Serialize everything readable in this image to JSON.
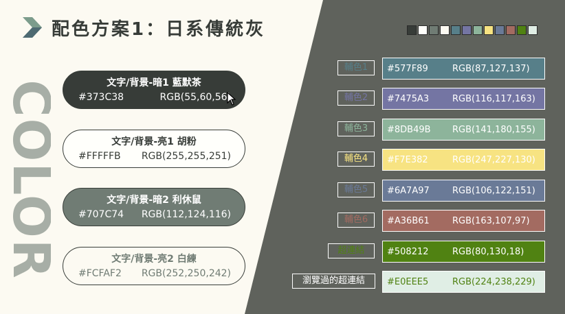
{
  "title": "配色方案1：日系傳統灰",
  "side_word": "COLOR",
  "colors": {
    "page_light": "#FCFAF2",
    "page_dark": "#5F625C",
    "chevron_light": "#7C9C8C",
    "chevron_dark": "#4E6A72",
    "side_word": "#A7AEA6"
  },
  "main_colors": [
    {
      "name": "文字/背景-暗1 藍默茶",
      "hex": "#373C38",
      "rgb": "RGB(55,60,56)",
      "fill": "#373C38",
      "text": "#FFFFFF",
      "border": "#373C38"
    },
    {
      "name": "文字/背景-亮1 胡粉",
      "hex": "#FFFFFB",
      "rgb": "RGB(255,255,251)",
      "fill": "#FFFFFB",
      "text": "#373C38",
      "border": "#373C38"
    },
    {
      "name": "文字/背景-暗2 利休鼠",
      "hex": "#707C74",
      "rgb": "RGB(112,124,116)",
      "fill": "#707C74",
      "text": "#FFFFFF",
      "border": "#373C38"
    },
    {
      "name": "文字/背景-亮2 白練",
      "hex": "#FCFAF2",
      "rgb": "RGB(252,250,242)",
      "fill": "#FCFAF2",
      "text": "#707C74",
      "border": "#373C38"
    }
  ],
  "swatch_strip": [
    "#373C38",
    "#FFFFFB",
    "#707C74",
    "#FCFAF2",
    "#577F89",
    "#7475A3",
    "#8DB49B",
    "#F7E382",
    "#6A7A97",
    "#A36B61",
    "#508212",
    "#E0EEE5"
  ],
  "accents": [
    {
      "label": "輔色1",
      "hex": "#577F89",
      "rgb": "RGB(87,127,137)",
      "fill": "#577F89",
      "label_color": "#577F89",
      "text": "#FFFFFF"
    },
    {
      "label": "輔色2",
      "hex": "#7475A3",
      "rgb": "RGB(116,117,163)",
      "fill": "#7475A3",
      "label_color": "#7475A3",
      "text": "#FFFFFF"
    },
    {
      "label": "輔色3",
      "hex": "#8DB49B",
      "rgb": "RGB(141,180,155)",
      "fill": "#8DB49B",
      "label_color": "#8DB49B",
      "text": "#FFFFFF"
    },
    {
      "label": "輔色4",
      "hex": "#F7E382",
      "rgb": "RGB(247,227,130)",
      "fill": "#F7E382",
      "label_color": "#F7E382",
      "text": "#FFFFFF"
    },
    {
      "label": "輔色5",
      "hex": "#6A7A97",
      "rgb": "RGB(106,122,151)",
      "fill": "#6A7A97",
      "label_color": "#6A7A97",
      "text": "#FFFFFF"
    },
    {
      "label": "輔色6",
      "hex": "#A36B61",
      "rgb": "RGB(163,107,97)",
      "fill": "#A36B61",
      "label_color": "#A36B61",
      "text": "#FFFFFF"
    },
    {
      "label": "超連結",
      "hex": "#508212",
      "rgb": "RGB(80,130,18)",
      "fill": "#508212",
      "label_color": "#508212",
      "text": "#FFFFFF"
    },
    {
      "label": "瀏覽過的超連結",
      "hex": "#E0EEE5",
      "rgb": "RGB(224,238,229)",
      "fill": "#E0EEE5",
      "label_color": "#FFFFFF",
      "text": "#508212"
    }
  ]
}
